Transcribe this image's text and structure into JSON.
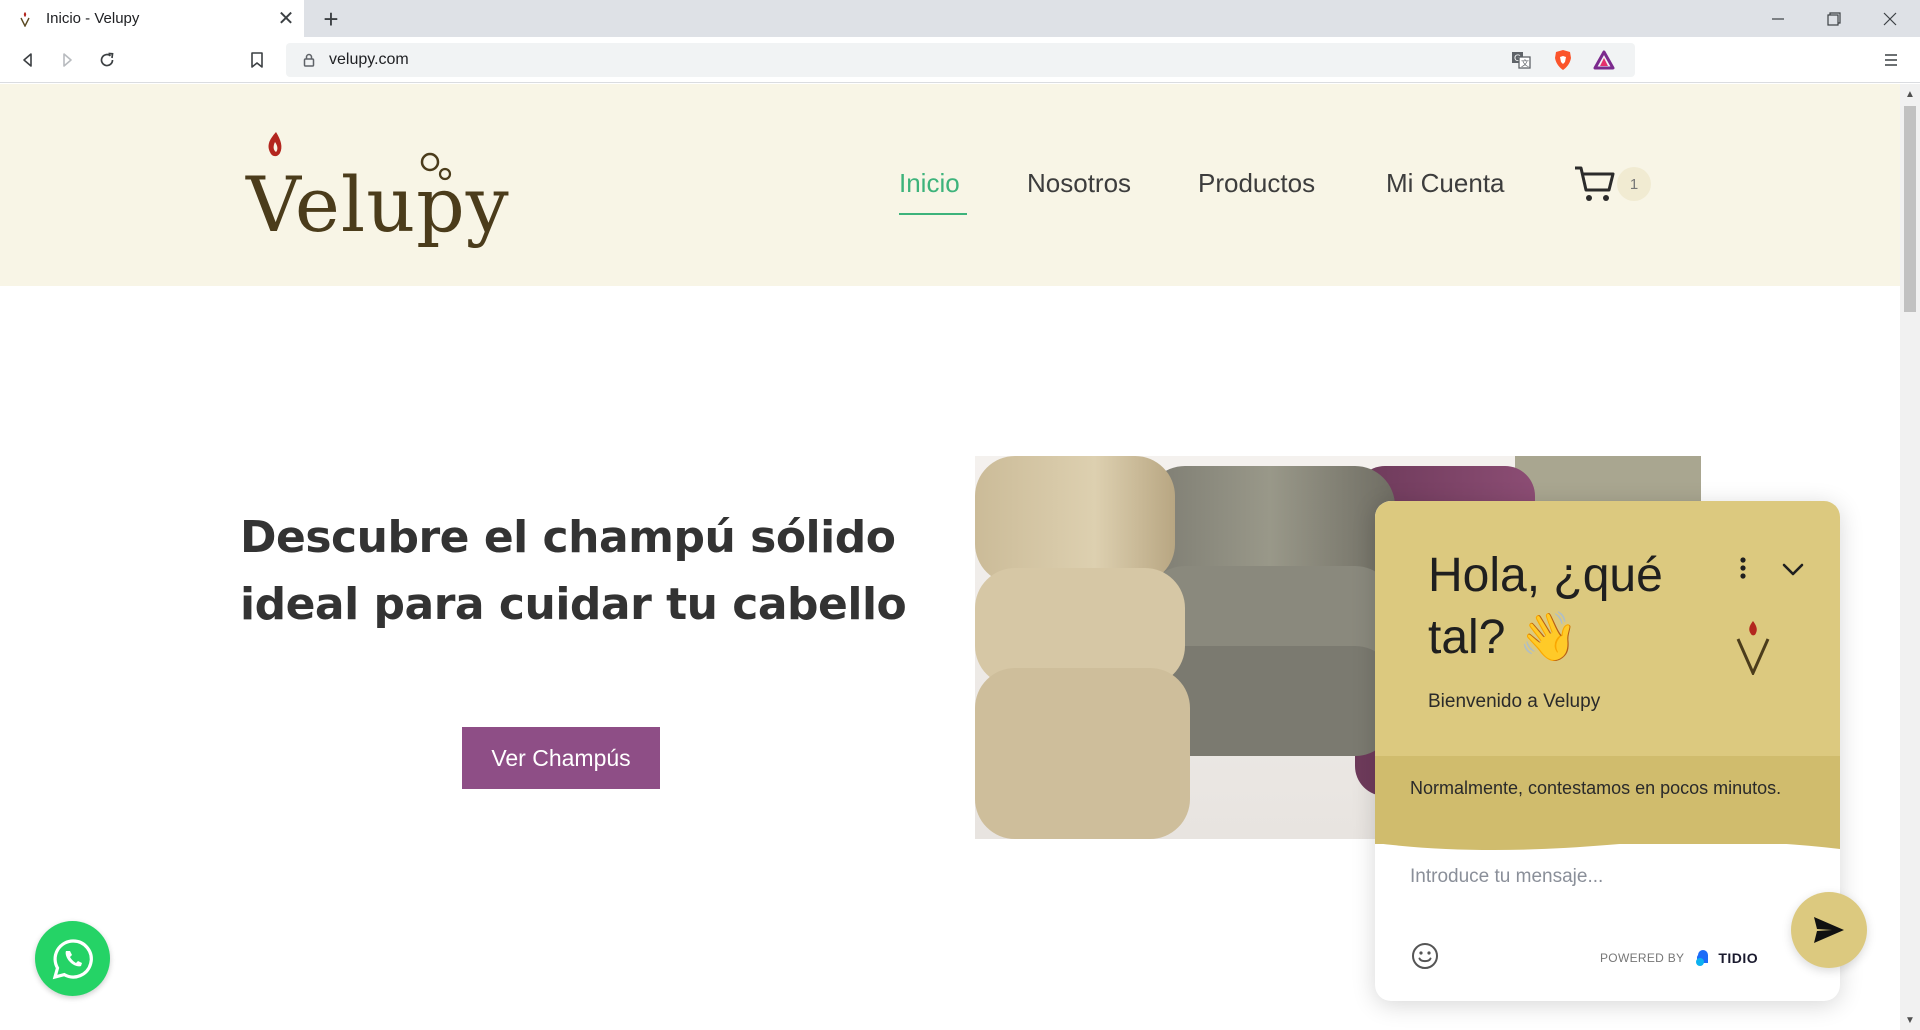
{
  "browser": {
    "tab_title": "Inicio - Velupy",
    "tab_close": "✕",
    "new_tab": "+",
    "url": "velupy.com",
    "window_controls": [
      "minimize",
      "restore",
      "close"
    ]
  },
  "site": {
    "logo_text": "Velupy",
    "nav": {
      "inicio": "Inicio",
      "nosotros": "Nosotros",
      "productos": "Productos",
      "mi_cuenta": "Mi Cuenta"
    },
    "cart_count": "1"
  },
  "hero": {
    "title": "Descubre el champú sólido ideal para cuidar tu cabello",
    "button": "Ver Champús"
  },
  "chat": {
    "greeting": "Hola, ¿qué tal? 👋",
    "welcome": "Bienvenido a Velupy",
    "response_note": "Normalmente, contestamos en pocos minutos.",
    "input_placeholder": "Introduce tu mensaje...",
    "powered_by": "POWERED BY",
    "brand": "TIDIO"
  },
  "colors": {
    "nav_active": "#3db37b",
    "header_bg": "#f8f5e6",
    "button_bg": "#8e4e86",
    "chat_bg": "#dcc97f",
    "whatsapp": "#25d366"
  }
}
